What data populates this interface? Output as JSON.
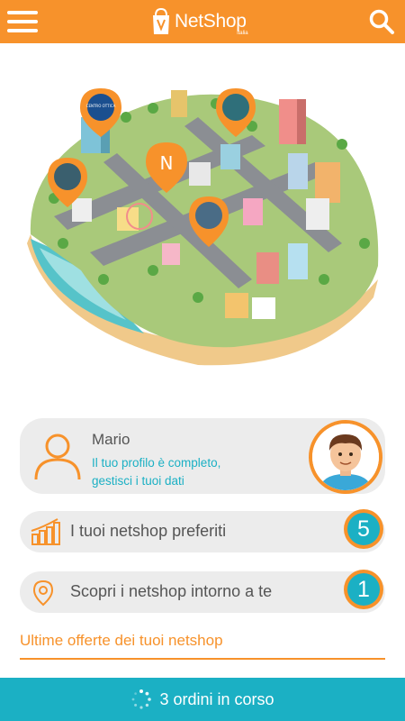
{
  "header": {
    "logo_text": "NetShop",
    "logo_sub": "italia",
    "menu_icon": "hamburger-icon",
    "search_icon": "search-icon"
  },
  "map": {
    "center_pin_letter": "N",
    "pin_labels": [
      "CENTRO OTTICA"
    ]
  },
  "profile": {
    "name": "Mario",
    "status_line1": "Il tuo profilo è completo,",
    "status_line2": "gestisci i tuoi dati"
  },
  "favorites": {
    "label": "I tuoi netshop preferiti",
    "count": "5",
    "icon": "bar-chart-icon"
  },
  "nearby": {
    "label": "Scopri i netshop intorno a te",
    "count": "1",
    "icon": "location-pin-icon"
  },
  "offers": {
    "title": "Ultime offerte dei tuoi netshop"
  },
  "footer": {
    "orders_label": "3 ordini in corso",
    "icon": "spinner-icon"
  },
  "colors": {
    "accent": "#f7922b",
    "teal": "#1bb0c4",
    "card": "#ececec"
  }
}
